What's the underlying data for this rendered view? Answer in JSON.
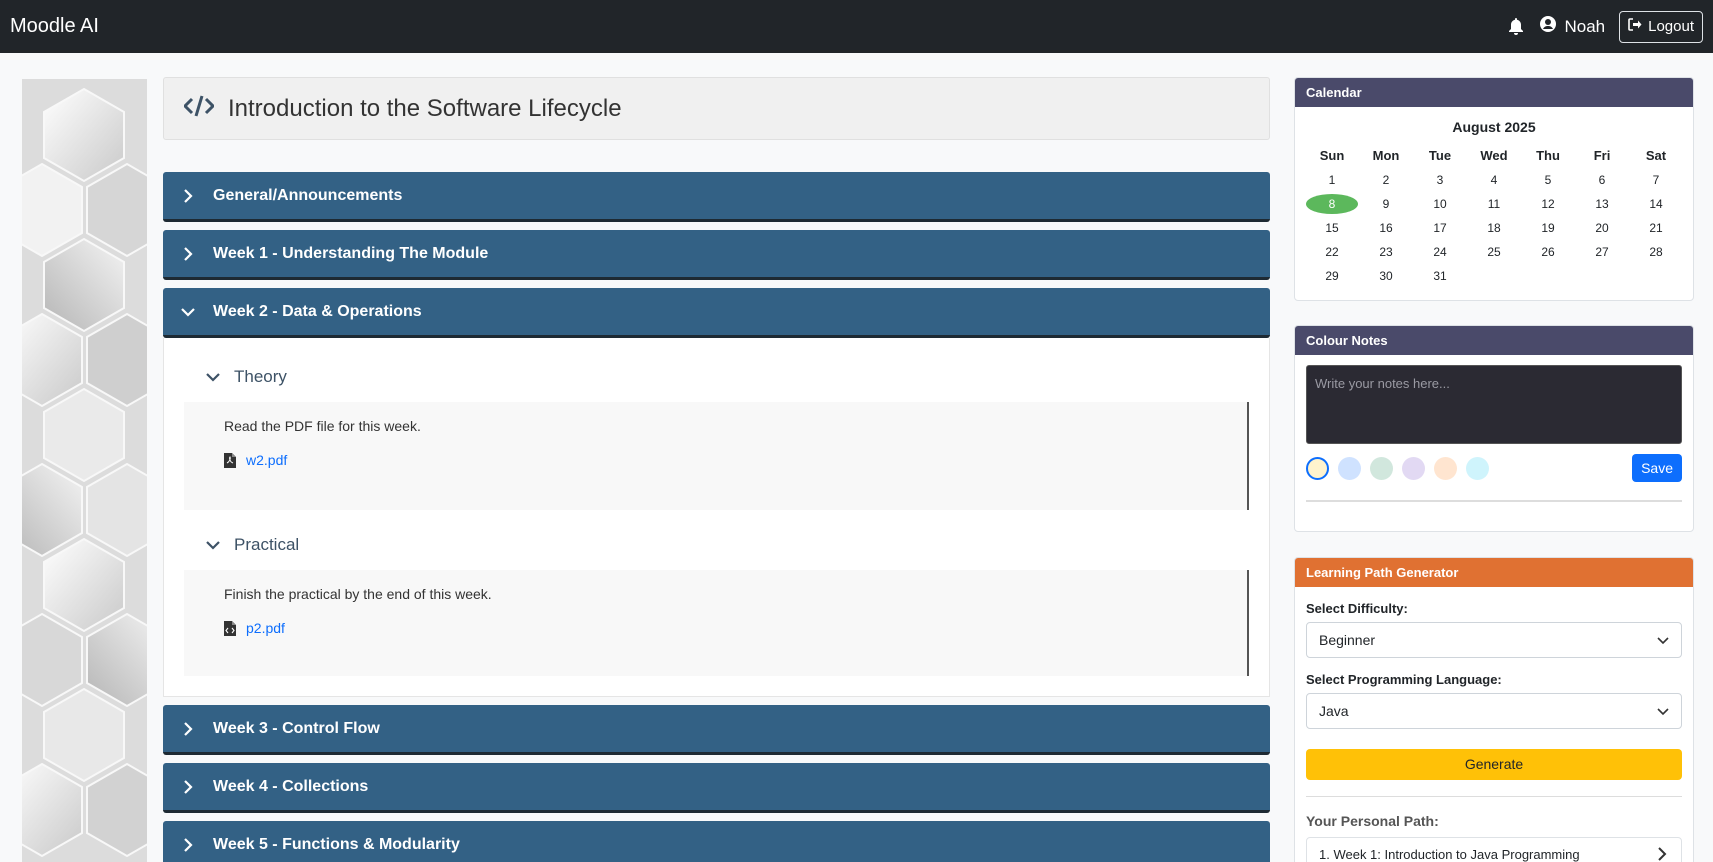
{
  "topbar": {
    "brand": "Moodle AI",
    "user_name": "Noah",
    "logout_label": "Logout"
  },
  "course": {
    "title": "Introduction to the Software Lifecycle"
  },
  "sections": [
    {
      "label": "General/Announcements",
      "expanded": false
    },
    {
      "label": "Week 1 - Understanding The Module",
      "expanded": false
    },
    {
      "label": "Week 2 - Data & Operations",
      "expanded": true
    },
    {
      "label": "Week 3 - Control Flow",
      "expanded": false
    },
    {
      "label": "Week 4 - Collections",
      "expanded": false
    },
    {
      "label": "Week 5 - Functions & Modularity",
      "expanded": false
    }
  ],
  "week2": {
    "theory": {
      "heading": "Theory",
      "text": "Read the PDF file for this week.",
      "file": "w2.pdf"
    },
    "practical": {
      "heading": "Practical",
      "text": "Finish the practical by the end of this week.",
      "file": "p2.pdf"
    }
  },
  "calendar": {
    "header": "Calendar",
    "month": "August 2025",
    "weekdays": [
      "Sun",
      "Mon",
      "Tue",
      "Wed",
      "Thu",
      "Fri",
      "Sat"
    ],
    "days": [
      "1",
      "2",
      "3",
      "4",
      "5",
      "6",
      "7",
      "8",
      "9",
      "10",
      "11",
      "12",
      "13",
      "14",
      "15",
      "16",
      "17",
      "18",
      "19",
      "20",
      "21",
      "22",
      "23",
      "24",
      "25",
      "26",
      "27",
      "28",
      "29",
      "30",
      "31"
    ],
    "today": "8"
  },
  "notes": {
    "header": "Colour Notes",
    "placeholder": "Write your notes here...",
    "save_label": "Save",
    "swatch_colors": [
      "#fff3cd",
      "#cfe2ff",
      "#d1e7dd",
      "#e2d9f3",
      "#ffe5d0",
      "#cff4fc"
    ],
    "selected_swatch": "#fff3cd"
  },
  "learning_path": {
    "header": "Learning Path Generator",
    "difficulty_label": "Select Difficulty:",
    "difficulty_value": "Beginner",
    "language_label": "Select Programming Language:",
    "language_value": "Java",
    "generate_label": "Generate",
    "path_label": "Your Personal Path:",
    "path_items": [
      "1. Week 1: Introduction to Java Programming"
    ]
  },
  "colors": {
    "topbar": "#212529",
    "section_bar": "#336185",
    "calendar_header": "#4a4a6a",
    "notes_header": "#4a4a6a",
    "learning_path_header": "#e07132",
    "generate_button": "#ffc107",
    "save_button": "#0d6efd",
    "today_highlight": "#5cb85c"
  }
}
